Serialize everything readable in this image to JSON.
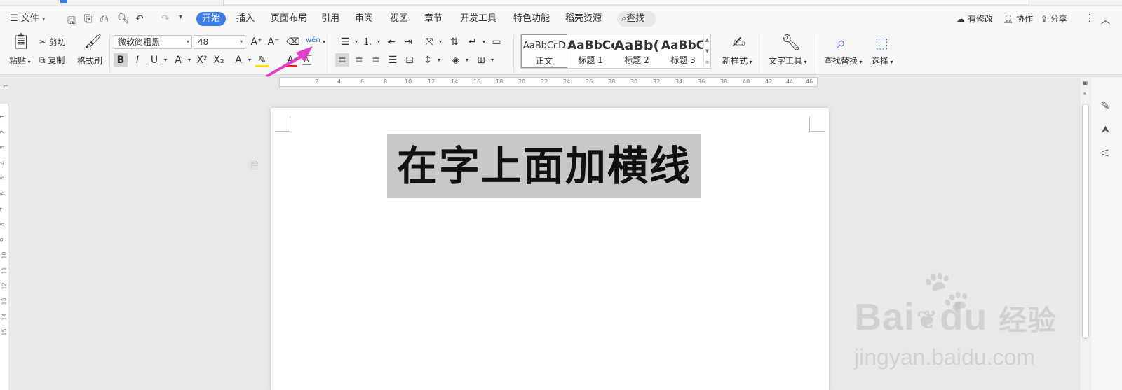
{
  "menubar": {
    "file_label": "文件",
    "tabs": [
      "开始",
      "插入",
      "页面布局",
      "引用",
      "审阅",
      "视图",
      "章节",
      "开发工具",
      "特色功能",
      "稻壳资源"
    ],
    "search_label": "查找",
    "modified_label": "有修改",
    "collab_label": "协作",
    "share_label": "分享"
  },
  "ribbon": {
    "paste_label": "粘贴",
    "cut_label": "剪切",
    "copy_label": "复制",
    "format_painter_label": "格式刷",
    "font_name": "微软简粗黑",
    "font_size": "48",
    "styles": [
      {
        "preview": "AaBbCcD",
        "label": "正文"
      },
      {
        "preview": "AaBbCc",
        "label": "标题 1"
      },
      {
        "preview": "AaBb(",
        "label": "标题 2"
      },
      {
        "preview": "AaBbC",
        "label": "标题 3"
      }
    ],
    "new_style_label": "新样式",
    "text_tools_label": "文字工具",
    "find_replace_label": "查找替换",
    "select_label": "选择"
  },
  "ruler": {
    "ticks": [
      "2",
      "4",
      "6",
      "8",
      "10",
      "12",
      "14",
      "16",
      "18",
      "20",
      "22",
      "24",
      "26",
      "28",
      "30",
      "32",
      "34",
      "36",
      "38",
      "40",
      "42",
      "44",
      "46"
    ],
    "vticks": [
      "1",
      "2",
      "3",
      "4",
      "5",
      "6",
      "7",
      "8",
      "9",
      "10",
      "11",
      "12",
      "13",
      "14",
      "15"
    ]
  },
  "document": {
    "heading": "在字上面加横线"
  },
  "watermark": {
    "brand": "Bai",
    "brand2": "du",
    "brand_cn": "经验",
    "site": "jingyan.baidu.com"
  },
  "colors": {
    "accent": "#3c7ee6",
    "arrow": "#e040c8",
    "selection": "#c8c8c8"
  }
}
